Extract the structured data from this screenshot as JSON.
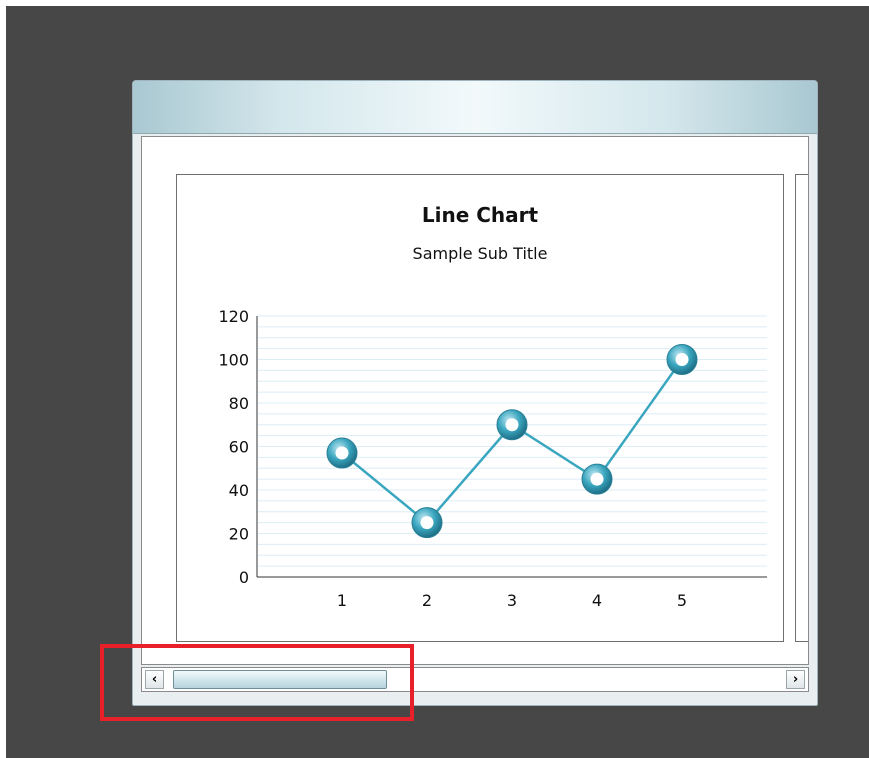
{
  "chart": {
    "title": "Line Chart",
    "subtitle": "Sample Sub Title"
  },
  "chart_data": {
    "type": "line",
    "title": "Line Chart",
    "subtitle": "Sample Sub Title",
    "xlabel": "",
    "ylabel": "",
    "categories": [
      "1",
      "2",
      "3",
      "4",
      "5"
    ],
    "series": [
      {
        "values": [
          57,
          25,
          70,
          45,
          100
        ]
      }
    ],
    "ylim": [
      0,
      120
    ],
    "yticks": [
      0,
      20,
      40,
      60,
      80,
      100,
      120
    ],
    "grid": true,
    "legend": "none"
  },
  "scrollbar": {
    "left_arrow": "‹",
    "right_arrow": "›",
    "thumb_fraction": 0.33
  },
  "colors": {
    "line": "#3aa6bf",
    "marker": "#2f8fa9",
    "gridline": "#dbeef5",
    "highlight": "#e8202a",
    "background": "#474747"
  }
}
